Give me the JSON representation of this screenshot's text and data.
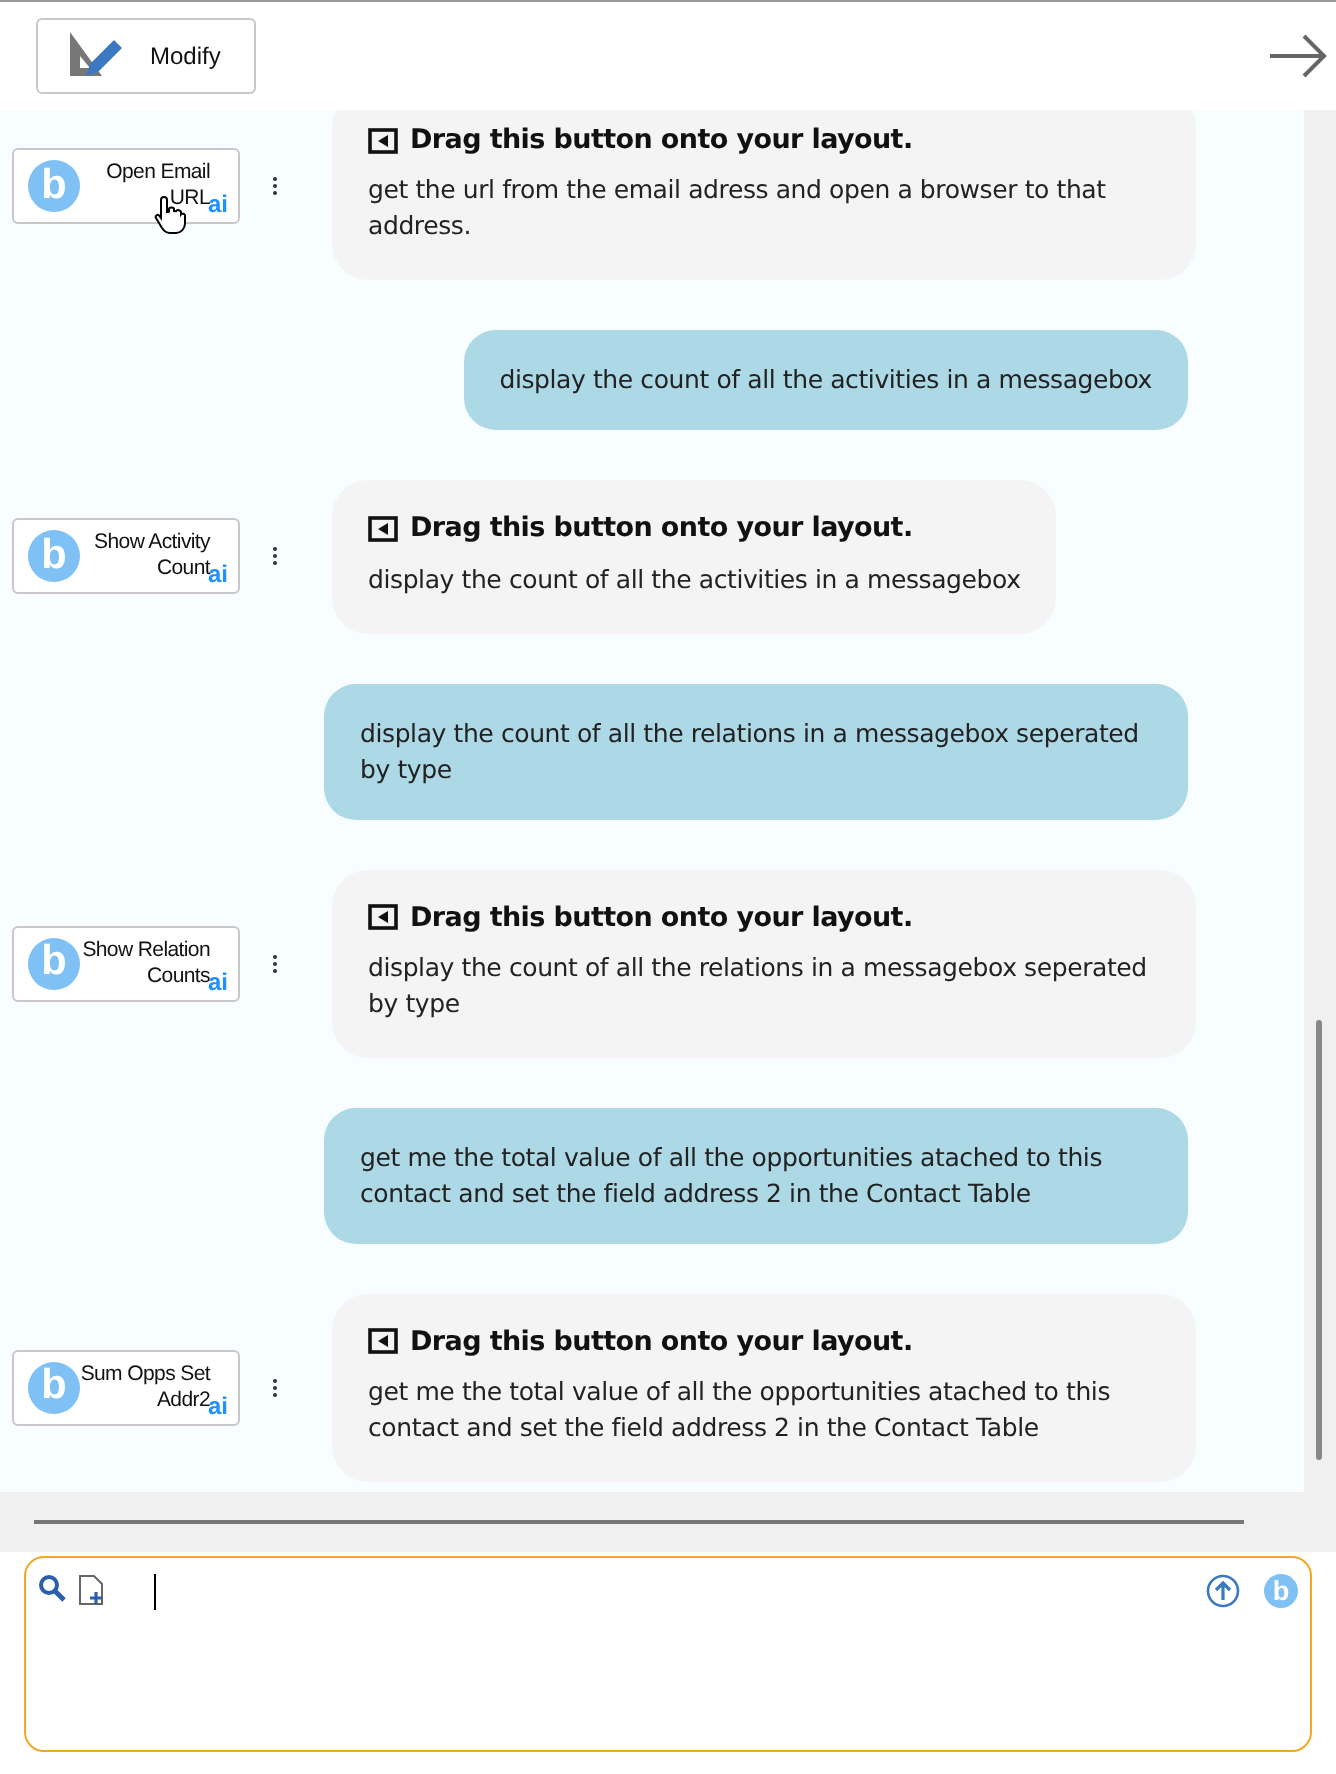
{
  "toolbar": {
    "modify_label": "Modify"
  },
  "messages": [
    {
      "kind": "bot",
      "button_label": "Open Email URL",
      "logo_letter": "b",
      "badge": "ai",
      "hovered": true,
      "drag_hint": "Drag this button onto your layout.",
      "text": "get the url from the email adress and open a browser to that address."
    },
    {
      "kind": "user",
      "text": "display the count of all the activities in a messagebox"
    },
    {
      "kind": "bot",
      "button_label": "Show Activity Count",
      "logo_letter": "b",
      "badge": "ai",
      "hovered": false,
      "drag_hint": "Drag this button onto your layout.",
      "text": "display the count of all the activities in a messagebox"
    },
    {
      "kind": "user",
      "text": "display the count of all the relations in a messagebox seperated by type"
    },
    {
      "kind": "bot",
      "button_label": "Show Relation Counts",
      "logo_letter": "b",
      "badge": "ai",
      "hovered": false,
      "drag_hint": "Drag this button onto your layout.",
      "text": "display the count of all the relations in a messagebox seperated by type"
    },
    {
      "kind": "user",
      "text": "get me the total value of all the opportunities atached to this contact and set the field address 2 in the Contact Table"
    },
    {
      "kind": "bot",
      "button_label": "Sum Opps Set Addr2",
      "logo_letter": "b",
      "badge": "ai",
      "hovered": false,
      "drag_hint": "Drag this button onto your layout.",
      "text": "get me the total value of all the opportunities atached to this contact and set the field address 2 in the Contact Table"
    }
  ],
  "composer": {
    "logo_letter": "b"
  }
}
